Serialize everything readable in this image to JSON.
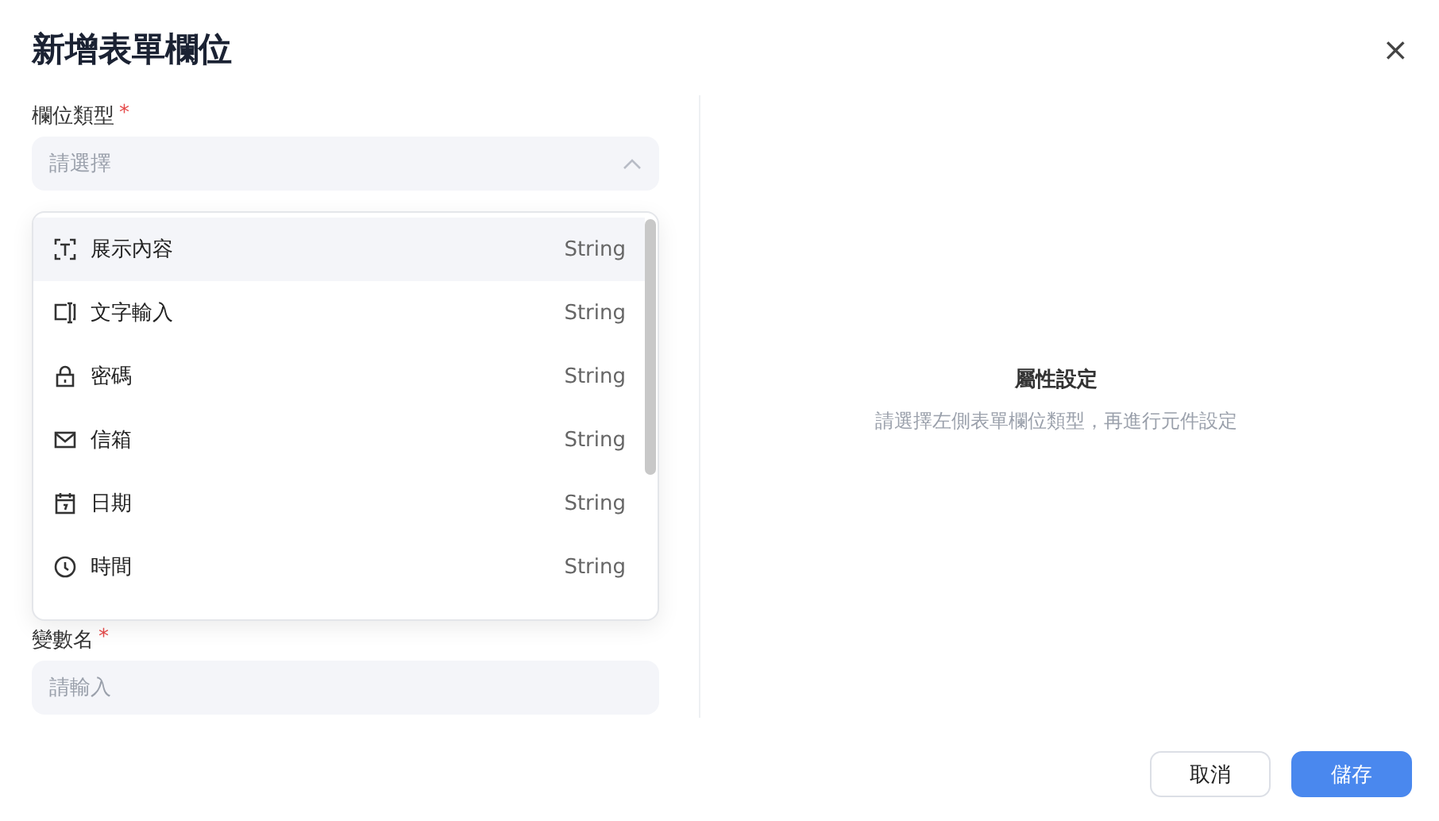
{
  "dialog": {
    "title": "新增表單欄位",
    "close": "×"
  },
  "fields": [
    {
      "label": "欄位類型",
      "required_mark": "*",
      "kind": "select",
      "placeholder": "請選擇",
      "expanded": true
    },
    {
      "label": "變數名",
      "required_mark": "*",
      "kind": "input",
      "placeholder": "請輸入"
    }
  ],
  "dropdown": {
    "options": [
      {
        "kind": "text",
        "label": "展示內容",
        "type": "String",
        "selected": true
      },
      {
        "kind": "input",
        "label": "文字輸入",
        "type": "String",
        "selected": false
      },
      {
        "kind": "lock",
        "label": "密碼",
        "type": "String",
        "selected": false
      },
      {
        "kind": "mail",
        "label": "信箱",
        "type": "String",
        "selected": false
      },
      {
        "kind": "calendar",
        "label": "日期",
        "type": "String",
        "selected": false
      },
      {
        "kind": "clock",
        "label": "時間",
        "type": "String",
        "selected": false
      }
    ]
  },
  "properties": {
    "title": "屬性設定",
    "hint": "請選擇左側表單欄位類型，再進行元件設定"
  },
  "buttons": [
    {
      "label": "取消",
      "kind": "secondary"
    },
    {
      "label": "儲存",
      "kind": "primary"
    }
  ]
}
